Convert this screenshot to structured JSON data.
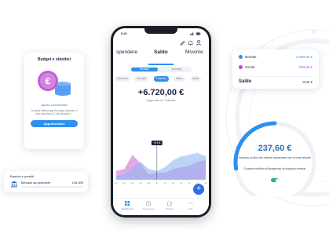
{
  "budget_card": {
    "title": "Budget e obiettivi",
    "subtitle": "Spesa concentrata",
    "description": "Jemecia elltinscrage ill budget expense ei lese expenses 11 sitici budget e...",
    "button_label": "Approfondisci"
  },
  "bank_card": {
    "header": "Banche e prestiti",
    "item_label": "Bilmaoli da spendere",
    "item_amount": "100,00€"
  },
  "phone": {
    "status_time": "9:41",
    "tabs": [
      "spendere",
      "Saldo",
      "Movime"
    ],
    "segment": {
      "active": "Mensile",
      "inactive": "Annuale"
    },
    "months": [
      "Dicembre",
      "Gennaio",
      "Febbraio",
      "Marzo",
      "Aprile"
    ],
    "active_month_index": 2,
    "balance": "+6.720,00 €",
    "updated_label": "Aggiornato al 7 febbraio",
    "tooltip": "+5.6 €",
    "chart_axis_labels": [
      "gen",
      "feb",
      "mar",
      "apr",
      "mag",
      "giu",
      "lug",
      "ago",
      "set",
      "ott",
      "nov",
      "dic"
    ],
    "nav": [
      "Dashboard",
      "Transazioni",
      "Budget",
      "Altro"
    ],
    "fab_label": "+"
  },
  "chart_data": {
    "type": "area",
    "x": [
      "gen",
      "feb",
      "mar",
      "apr",
      "mag",
      "giu",
      "lug",
      "ago",
      "set",
      "ott",
      "nov",
      "dic"
    ],
    "series": [
      {
        "values": [
          10,
          12,
          28,
          18,
          6,
          8,
          8,
          12,
          14,
          16,
          20,
          22
        ]
      },
      {
        "values": [
          4,
          6,
          14,
          20,
          12,
          10,
          14,
          22,
          26,
          28,
          30,
          26
        ]
      }
    ],
    "colors": [
      "#d88ce0",
      "#8fb8f0"
    ]
  },
  "eu_card": {
    "entrate_label": "Entrate",
    "entrate_value": "1.000,00 €",
    "uscite_label": "Uscite",
    "uscite_value": "200,00 €",
    "saldo_label": "Saldo",
    "saldo_value": "0,00 €",
    "entrate_color": "#2f8ff0",
    "uscite_color": "#b44fd6"
  },
  "gauge": {
    "amount": "237,60 €",
    "description": "Imposta la cifra che intendi risparmiare per il mese attuale",
    "consent": "Consenti notifiche sull'andamento del risparmio mensile",
    "progress": 0.55,
    "color": "#2f8ff0"
  }
}
